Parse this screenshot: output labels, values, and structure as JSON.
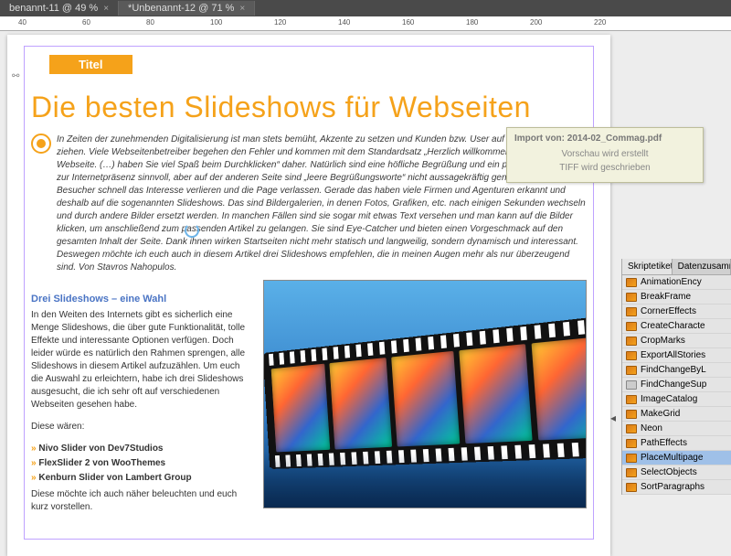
{
  "tabs": [
    {
      "label": "benannt-11 @ 49 %",
      "active": false
    },
    {
      "label": "*Unbenannt-12 @ 71 %",
      "active": true
    }
  ],
  "ruler": [
    "40",
    "60",
    "80",
    "100",
    "120",
    "140",
    "160",
    "180",
    "200",
    "220"
  ],
  "doc": {
    "title_tab": "Titel",
    "headline": "Die besten Slideshows für Webseiten",
    "intro": "In Zeiten der zunehmenden Digitalisierung ist man stets bemüht, Akzente zu setzen und Kunden bzw. User auf seine Seite zu ziehen. Viele Webseitenbetreiber begehen den Fehler und kommen mit dem Standardsatz „Herzlich willkommen auf unserer Webseite. (…) haben Sie viel Spaß beim Durchklicken“ daher. Natürlich sind eine höfliche Begrüßung und ein paar kleine Worte zur Internetpräsenz sinnvoll, aber auf der anderen Seite sind „leere Begrüßungsworte“ nicht aussagekräftig genug, sodass Besucher schnell das Interesse verlieren und die Page verlassen. Gerade das haben viele Firmen und Agenturen erkannt und deshalb auf die sogenannten Slideshows. Das sind Bildergalerien, in denen Fotos, Grafiken, etc. nach einigen Sekunden wechseln und durch andere Bilder ersetzt werden. In manchen Fällen sind sie sogar mit etwas Text versehen und man kann auf die Bilder klicken, um anschließend zum passenden Artikel zu gelangen. Sie sind Eye-Catcher und bieten einen Vorgeschmack auf den gesamten Inhalt der Seite. Dank ihnen wirken Startseiten nicht mehr statisch und langweilig, sondern dynamisch und interessant. Deswegen möchte ich euch auch in diesem Artikel drei Slideshows empfehlen, die in meinen Augen mehr als nur überzeugend sind. Von Stavros Nahopulos.",
    "subhead": "Drei Slideshows – eine Wahl",
    "col_p1": "In den Weiten des Internets gibt es sicherlich eine Menge Slideshows, die über gute Funktionalität, tolle Effekte und interessante Optionen verfügen. Doch leider würde es natürlich den Rahmen sprengen, alle Slideshows in diesem Artikel aufzuzählen. Um euch die Auswahl zu erleichtern, habe ich drei Slideshows ausgesucht, die ich sehr oft auf verschiedenen Webseiten gesehen habe.",
    "col_p2": "Diese wären:",
    "bullets": [
      "Nivo Slider von Dev7Studios",
      "FlexSlider 2 von WooThemes",
      "Kenburn Slider von Lambert Group"
    ],
    "col_p3": "Diese möchte ich auch näher beleuchten und euch kurz vorstellen."
  },
  "tooltip": {
    "line1": "Import von: 2014-02_Commag.pdf",
    "line2": "Vorschau wird erstellt",
    "line3": "TIFF wird geschrieben"
  },
  "panel": {
    "tabs": [
      "Skriptetikett",
      "Datenzusamm"
    ],
    "items": [
      {
        "label": "AnimationEncy",
        "folder": false
      },
      {
        "label": "BreakFrame",
        "folder": false
      },
      {
        "label": "CornerEffects",
        "folder": false
      },
      {
        "label": "CreateCharacte",
        "folder": false
      },
      {
        "label": "CropMarks",
        "folder": false
      },
      {
        "label": "ExportAllStories",
        "folder": false
      },
      {
        "label": "FindChangeByL",
        "folder": false
      },
      {
        "label": "FindChangeSup",
        "folder": true
      },
      {
        "label": "ImageCatalog",
        "folder": false
      },
      {
        "label": "MakeGrid",
        "folder": false
      },
      {
        "label": "Neon",
        "folder": false
      },
      {
        "label": "PathEffects",
        "folder": false
      },
      {
        "label": "PlaceMultipage",
        "folder": false,
        "selected": true
      },
      {
        "label": "SelectObjects",
        "folder": false
      },
      {
        "label": "SortParagraphs",
        "folder": false
      }
    ]
  }
}
